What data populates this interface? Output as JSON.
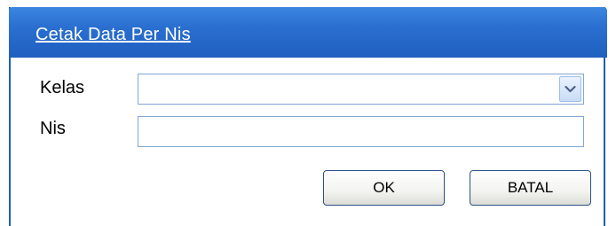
{
  "dialog": {
    "title": "Cetak Data Per Nis"
  },
  "form": {
    "kelas_label": "Kelas",
    "kelas_value": "",
    "nis_label": "Nis",
    "nis_value": ""
  },
  "buttons": {
    "ok_label": "OK",
    "batal_label": "BATAL"
  },
  "icons": {
    "dropdown": "chevron-down-icon"
  },
  "colors": {
    "titlebar": "#2a6fd0",
    "input_border": "#7fa6d6",
    "button_border": "#2b4f86"
  }
}
